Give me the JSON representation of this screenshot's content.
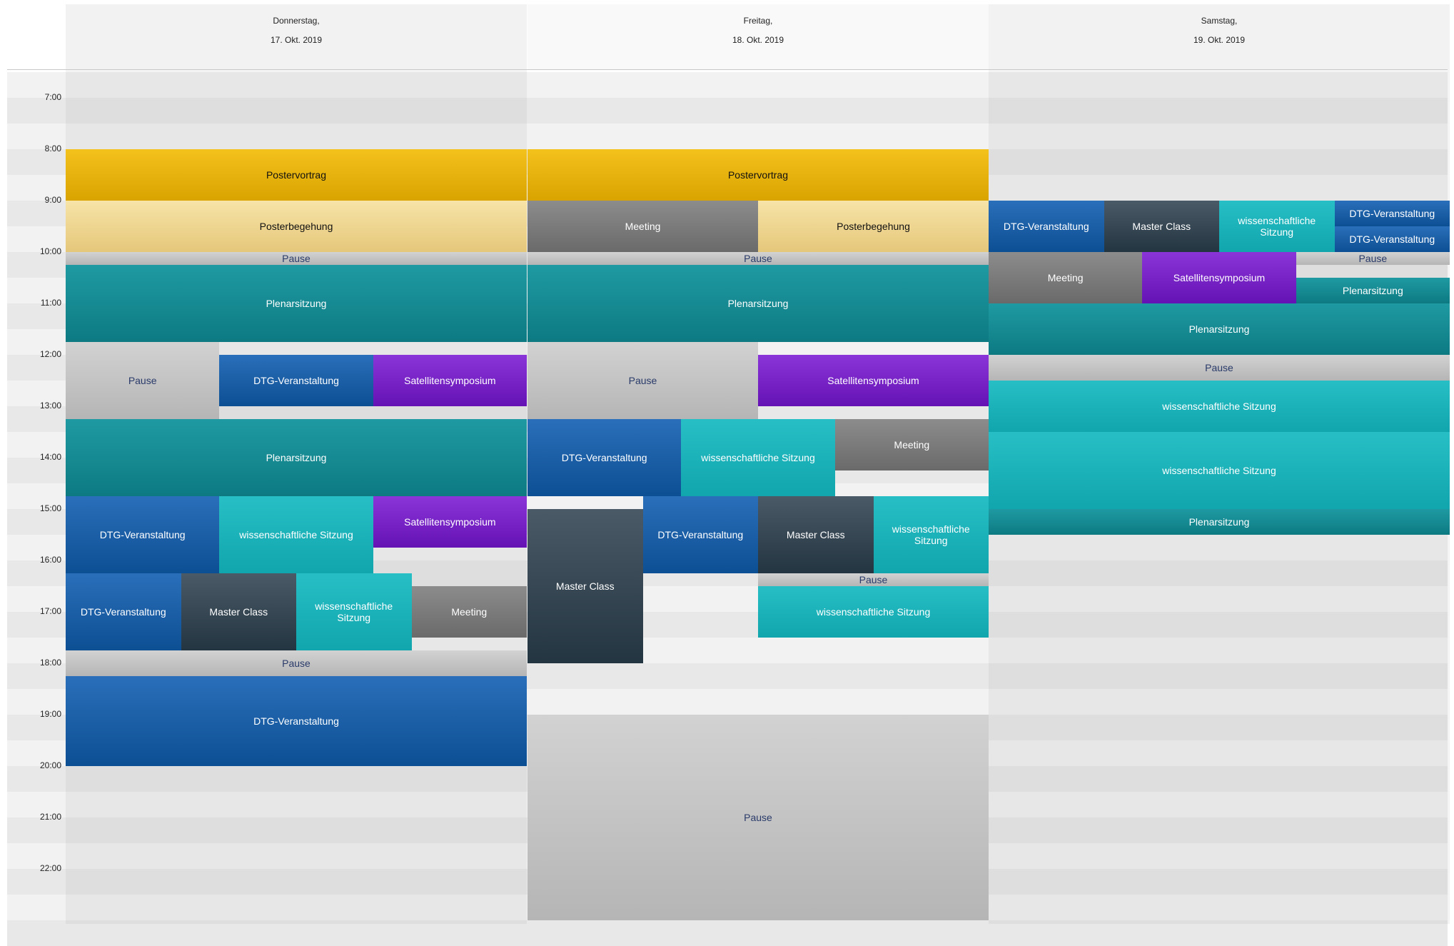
{
  "time_labels": [
    "7:00",
    "8:00",
    "9:00",
    "10:00",
    "11:00",
    "12:00",
    "13:00",
    "14:00",
    "15:00",
    "16:00",
    "17:00",
    "18:00",
    "19:00",
    "20:00",
    "21:00",
    "22:00"
  ],
  "days": [
    {
      "weekday": "Donnerstag,",
      "date": "17. Okt. 2019"
    },
    {
      "weekday": "Freitag,",
      "date": "18. Okt. 2019"
    },
    {
      "weekday": "Samstag,",
      "date": "19. Okt. 2019"
    }
  ],
  "event_types": {
    "poster": {
      "label": "Postervortrag",
      "color": "#f4c21c"
    },
    "posterbg": {
      "label": "Posterbegehung",
      "color": "#f7e4a8"
    },
    "pause": {
      "label": "Pause",
      "color": "#c4c4c4"
    },
    "plenar": {
      "label": "Plenarsitzung",
      "color": "#158a92"
    },
    "dtg": {
      "label": "DTG-Veranstaltung",
      "color": "#1c5fa8"
    },
    "sat": {
      "label": "Satellitensymposium",
      "color": "#7822c6"
    },
    "wiss": {
      "label": "wissenschaftliche Sitzung",
      "color": "#1cb2b9"
    },
    "master": {
      "label": "Master Class",
      "color": "#354552"
    },
    "meeting": {
      "label": "Meeting",
      "color": "#7b7b7b"
    }
  },
  "events": [
    {
      "day": 0,
      "type": "poster",
      "start": "8:00",
      "end": "9:00",
      "col": 0,
      "cols": 1
    },
    {
      "day": 0,
      "type": "posterbg",
      "start": "9:00",
      "end": "10:00",
      "col": 0,
      "cols": 1
    },
    {
      "day": 0,
      "type": "pause",
      "start": "10:00",
      "end": "10:15",
      "col": 0,
      "cols": 1
    },
    {
      "day": 0,
      "type": "plenar",
      "start": "10:15",
      "end": "11:45",
      "col": 0,
      "cols": 1
    },
    {
      "day": 0,
      "type": "pause",
      "start": "11:45",
      "end": "13:15",
      "col": 0,
      "cols": 3
    },
    {
      "day": 0,
      "type": "dtg",
      "start": "12:00",
      "end": "13:00",
      "col": 1,
      "cols": 3
    },
    {
      "day": 0,
      "type": "sat",
      "start": "12:00",
      "end": "13:00",
      "col": 2,
      "cols": 3
    },
    {
      "day": 0,
      "type": "plenar",
      "start": "13:15",
      "end": "14:45",
      "col": 0,
      "cols": 1
    },
    {
      "day": 0,
      "type": "dtg",
      "start": "14:45",
      "end": "16:15",
      "col": 0,
      "cols": 3
    },
    {
      "day": 0,
      "type": "wiss",
      "start": "14:45",
      "end": "16:15",
      "col": 1,
      "cols": 3
    },
    {
      "day": 0,
      "type": "sat",
      "start": "14:45",
      "end": "15:45",
      "col": 2,
      "cols": 3
    },
    {
      "day": 0,
      "type": "dtg",
      "start": "16:15",
      "end": "17:45",
      "col": 0,
      "cols": 4
    },
    {
      "day": 0,
      "type": "master",
      "start": "16:15",
      "end": "17:45",
      "col": 1,
      "cols": 4
    },
    {
      "day": 0,
      "type": "wiss",
      "start": "16:15",
      "end": "17:45",
      "col": 2,
      "cols": 4
    },
    {
      "day": 0,
      "type": "meeting",
      "start": "16:30",
      "end": "17:30",
      "col": 3,
      "cols": 4
    },
    {
      "day": 0,
      "type": "pause",
      "start": "17:45",
      "end": "18:15",
      "col": 0,
      "cols": 1
    },
    {
      "day": 0,
      "type": "dtg",
      "start": "18:15",
      "end": "20:00",
      "col": 0,
      "cols": 1
    },
    {
      "day": 1,
      "type": "poster",
      "start": "8:00",
      "end": "9:00",
      "col": 0,
      "cols": 1
    },
    {
      "day": 1,
      "type": "meeting",
      "start": "9:00",
      "end": "10:00",
      "col": 0,
      "cols": 2
    },
    {
      "day": 1,
      "type": "posterbg",
      "start": "9:00",
      "end": "10:00",
      "col": 1,
      "cols": 2
    },
    {
      "day": 1,
      "type": "pause",
      "start": "10:00",
      "end": "10:15",
      "col": 0,
      "cols": 1
    },
    {
      "day": 1,
      "type": "plenar",
      "start": "10:15",
      "end": "11:45",
      "col": 0,
      "cols": 1
    },
    {
      "day": 1,
      "type": "pause",
      "start": "11:45",
      "end": "13:15",
      "col": 0,
      "cols": 2
    },
    {
      "day": 1,
      "type": "sat",
      "start": "12:00",
      "end": "13:00",
      "col": 1,
      "cols": 2
    },
    {
      "day": 1,
      "type": "dtg",
      "start": "13:15",
      "end": "14:45",
      "col": 0,
      "cols": 3
    },
    {
      "day": 1,
      "type": "wiss",
      "start": "13:15",
      "end": "14:45",
      "col": 1,
      "cols": 3
    },
    {
      "day": 1,
      "type": "meeting",
      "start": "13:15",
      "end": "14:15",
      "col": 2,
      "cols": 3
    },
    {
      "day": 1,
      "type": "master",
      "start": "15:00",
      "end": "18:00",
      "col": 0,
      "cols": 4
    },
    {
      "day": 1,
      "type": "dtg",
      "start": "14:45",
      "end": "16:15",
      "col": 1,
      "cols": 4
    },
    {
      "day": 1,
      "type": "master",
      "start": "14:45",
      "end": "16:15",
      "col": 2,
      "cols": 4
    },
    {
      "day": 1,
      "type": "wiss",
      "start": "14:45",
      "end": "16:15",
      "col": 3,
      "cols": 4
    },
    {
      "day": 1,
      "type": "pause",
      "start": "16:15",
      "end": "16:30",
      "col": 2,
      "cols": 4,
      "span": 2
    },
    {
      "day": 1,
      "type": "wiss",
      "start": "16:30",
      "end": "17:30",
      "col": 2,
      "cols": 4,
      "span": 2
    },
    {
      "day": 1,
      "type": "pause",
      "start": "19:00",
      "end": "23:00",
      "col": 0,
      "cols": 1
    },
    {
      "day": 2,
      "type": "dtg",
      "start": "9:00",
      "end": "10:00",
      "col": 0,
      "cols": 4
    },
    {
      "day": 2,
      "type": "master",
      "start": "9:00",
      "end": "10:00",
      "col": 1,
      "cols": 4
    },
    {
      "day": 2,
      "type": "wiss",
      "start": "9:00",
      "end": "10:00",
      "col": 2,
      "cols": 4
    },
    {
      "day": 2,
      "type": "dtg",
      "start": "9:00",
      "end": "9:30",
      "col": 3,
      "cols": 4
    },
    {
      "day": 2,
      "type": "dtg",
      "start": "9:30",
      "end": "10:00",
      "col": 3,
      "cols": 4
    },
    {
      "day": 2,
      "type": "meeting",
      "start": "10:00",
      "end": "11:00",
      "col": 0,
      "cols": 3
    },
    {
      "day": 2,
      "type": "sat",
      "start": "10:00",
      "end": "11:00",
      "col": 1,
      "cols": 3
    },
    {
      "day": 2,
      "type": "pause",
      "start": "10:00",
      "end": "10:15",
      "col": 2,
      "cols": 3
    },
    {
      "day": 2,
      "type": "plenar",
      "start": "10:30",
      "end": "11:00",
      "col": 2,
      "cols": 3
    },
    {
      "day": 2,
      "type": "plenar",
      "start": "11:00",
      "end": "12:00",
      "col": 0,
      "cols": 1
    },
    {
      "day": 2,
      "type": "pause",
      "start": "12:00",
      "end": "12:30",
      "col": 0,
      "cols": 1
    },
    {
      "day": 2,
      "type": "wiss",
      "start": "12:30",
      "end": "13:30",
      "col": 0,
      "cols": 1
    },
    {
      "day": 2,
      "type": "wiss",
      "start": "13:30",
      "end": "15:00",
      "col": 0,
      "cols": 1
    },
    {
      "day": 2,
      "type": "plenar",
      "start": "15:00",
      "end": "15:30",
      "col": 0,
      "cols": 1
    }
  ]
}
